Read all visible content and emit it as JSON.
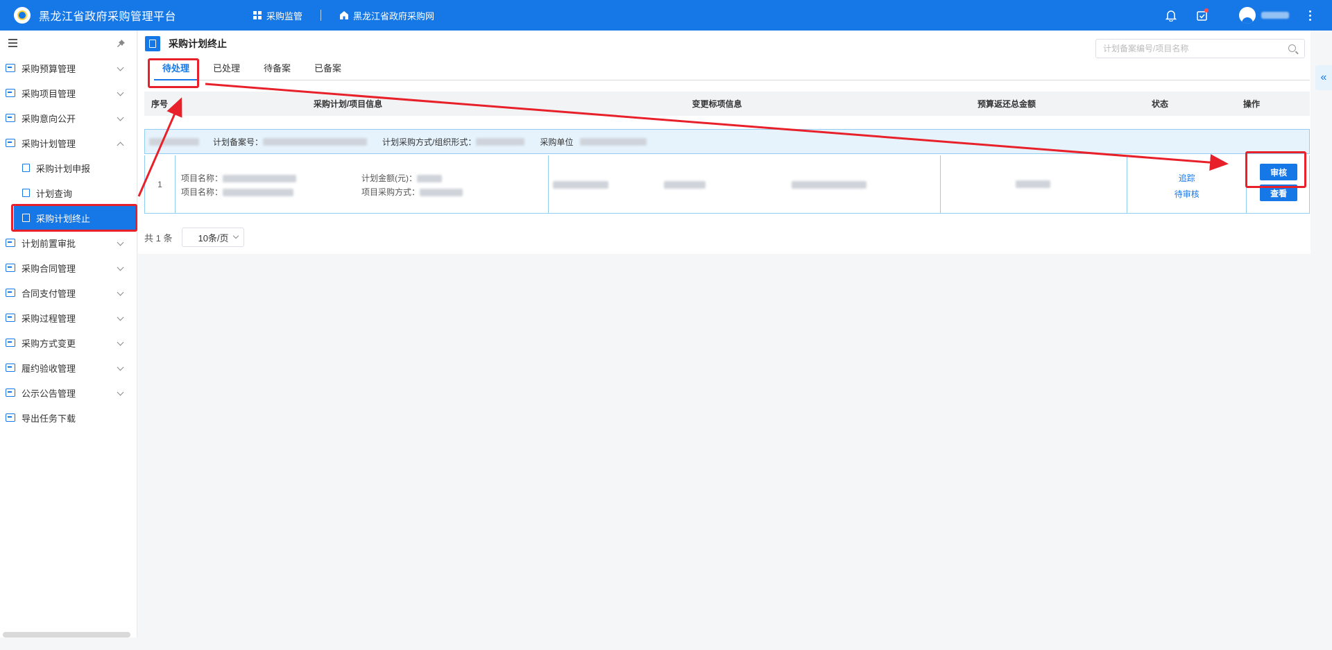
{
  "app": {
    "title": "黑龙江省政府采购管理平台"
  },
  "topnav": {
    "item1": "采购监管",
    "item2": "黑龙江省政府采购网"
  },
  "sidebar": {
    "items": [
      {
        "label": "采购预算管理"
      },
      {
        "label": "采购项目管理"
      },
      {
        "label": "采购意向公开"
      },
      {
        "label": "采购计划管理"
      },
      {
        "label": "计划前置审批"
      },
      {
        "label": "采购合同管理"
      },
      {
        "label": "合同支付管理"
      },
      {
        "label": "采购过程管理"
      },
      {
        "label": "采购方式变更"
      },
      {
        "label": "履约验收管理"
      },
      {
        "label": "公示公告管理"
      },
      {
        "label": "导出任务下载"
      }
    ],
    "subitems": [
      {
        "label": "采购计划申报"
      },
      {
        "label": "计划查询"
      },
      {
        "label": "采购计划终止"
      }
    ]
  },
  "page": {
    "title": "采购计划终止"
  },
  "search": {
    "placeholder": "计划备案编号/项目名称"
  },
  "tabs": [
    {
      "label": "待处理"
    },
    {
      "label": "已处理"
    },
    {
      "label": "待备案"
    },
    {
      "label": "已备案"
    }
  ],
  "table": {
    "headers": [
      "序号",
      "采购计划/项目信息",
      "变更标项信息",
      "预算返还总金额",
      "状态",
      "操作"
    ],
    "group": {
      "plan_no_label": "计划备案号：",
      "method_label": "计划采购方式/组织形式：",
      "unit_label": "采购单位"
    },
    "row": {
      "index": "1",
      "proj_name_label_1": "项目名称：",
      "proj_name_label_2": "项目名称：",
      "amount_label": "计划金额(元)：",
      "method_label": "项目采购方式：",
      "status_link": "追踪",
      "status_text": "待审核",
      "btn_review": "审核",
      "btn_view": "查看"
    }
  },
  "pager": {
    "total": "共 1 条",
    "page_size": "10条/页"
  },
  "colors": {
    "brand": "#1677e6",
    "annotation": "#e8202a"
  }
}
